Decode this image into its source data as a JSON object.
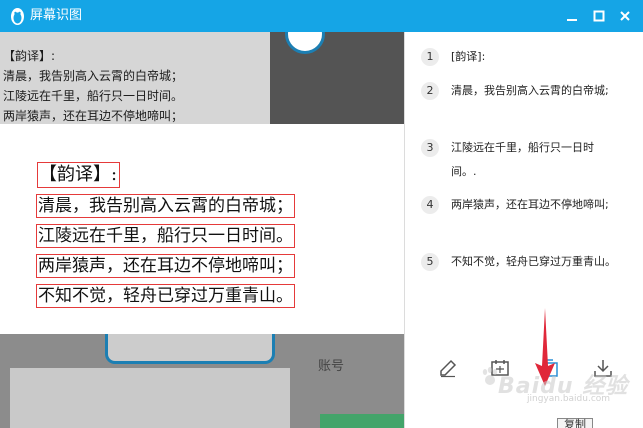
{
  "window": {
    "title": "屏幕识图",
    "app_icon": "penguin-icon",
    "controls": [
      "minimize-icon",
      "maximize-icon",
      "close-icon"
    ],
    "accent_color": "#15a5e6"
  },
  "background": {
    "lines": [
      "【韵译】:",
      "清晨，我告别高入云霄的白帝城；",
      "江陵远在千里，船行只一日时间。",
      "两岸猿声，还在耳边不停地啼叫；"
    ],
    "label": "账号"
  },
  "capture": {
    "heading": "【韵译】:",
    "lines": [
      "清晨，我告别高入云霄的白帝城；",
      "江陵远在千里，船行只一日时间。",
      "两岸猿声，还在耳边不停地啼叫；",
      "不知不觉，轻舟已穿过万重青山。"
    ],
    "box_color": "#e53a3a"
  },
  "results": [
    {
      "num": "1",
      "text": "[韵译]:"
    },
    {
      "num": "2",
      "text": "清晨，我告别高入云霄的白帝城;"
    },
    {
      "num": "3",
      "text": "江陵远在千里，船行只一日时间。."
    },
    {
      "num": "4",
      "text": "两岸猿声，还在耳边不停地啼叫;"
    },
    {
      "num": "5",
      "text": "不知不觉，轻舟已穿过万重青山。"
    }
  ],
  "toolbar": {
    "buttons": [
      "edit-icon",
      "translate-icon",
      "copy-icon",
      "download-icon"
    ],
    "tooltip": "复制"
  },
  "watermark": {
    "text": "Baidu 经验",
    "url": "jingyan.baidu.com"
  }
}
